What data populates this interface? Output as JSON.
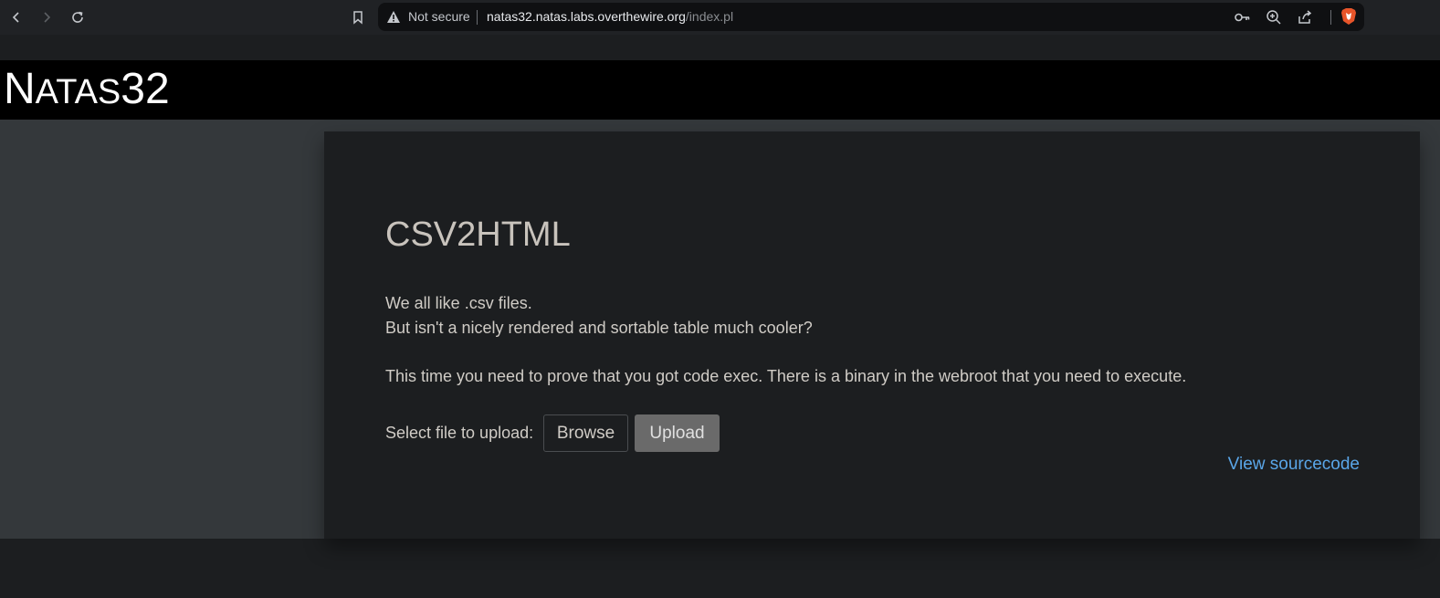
{
  "browser": {
    "security_label": "Not secure",
    "url_host": "natas32.natas.labs.overthewire.org",
    "url_path": "/index.pl"
  },
  "site": {
    "logo_big": "N",
    "logo_small": "ATAS",
    "logo_number": "32"
  },
  "main": {
    "title": "CSV2HTML",
    "intro_line1": "We all like .csv files.",
    "intro_line2": "But isn't a nicely rendered and sortable table much cooler?",
    "challenge": "This time you need to prove that you got code exec. There is a binary in the webroot that you need to execute.",
    "upload_label": "Select file to upload:",
    "browse_label": "Browse",
    "upload_button": "Upload",
    "source_link": "View sourcecode"
  },
  "colors": {
    "link": "#5aa6e8",
    "header_bg": "#000000",
    "content_bg": "#1c1e20"
  }
}
